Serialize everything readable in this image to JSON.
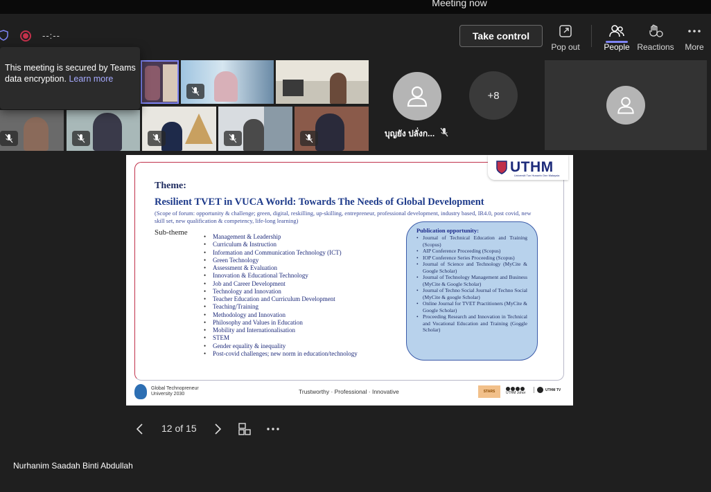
{
  "window": {
    "title": "Meeting now"
  },
  "toolbar": {
    "timer": "--:--",
    "take_control_label": "Take control",
    "pop_out_label": "Pop out",
    "people_label": "People",
    "reactions_label": "Reactions",
    "more_label": "More",
    "accent_color": "#7f85f5"
  },
  "tooltip": {
    "text": "This meeting is secured by Teams data encryption.",
    "link": "Learn more"
  },
  "participants": {
    "named_participant": "บุญยัง ปลั่งก...",
    "overflow_count": "+8"
  },
  "slide": {
    "logo_text": "UTHM",
    "logo_subtext": "Universiti Tun Hussein Onn Malaysia",
    "theme_label": "Theme:",
    "heading": "Resilient TVET in VUCA World: Towards The Needs of Global Development",
    "scope": "(Scope of forum: opportunity & challenge; green, digital, reskilling, up-skilling, entrepreneur, professional development, industry based, IR4.0, post covid, new skill set, new qualification & competency, life-long learning)",
    "subtheme_label": "Sub-theme",
    "subthemes": [
      "Management & Leadership",
      "Curriculum & Instruction",
      "Information and Communication Technology (ICT)",
      "Green Technology",
      "Assessment & Evaluation",
      "Innovation & Educational Technology",
      "Job and Career Development",
      "Technology and Innovation",
      "Teacher Education and Curriculum Development",
      "Teaching/Training",
      "Methodology and Innovation",
      "Philosophy and Values in Education",
      "Mobility and Internationalisation",
      "STEM",
      "Gender equality & inequality",
      "Post-covid challenges; new norm in education/technology"
    ],
    "publication_title": "Publication opportunity:",
    "publications": [
      "Journal of Technical Education and Training (Scopus)",
      "AIP Conference Proceeding (Scopus)",
      "IOP Conference Series Proceeding (Scopus)",
      "Journal of Science and Technology (MyCite & Google Scholar)",
      "Journal of Technology Management and Business (MyCite & Google Scholar)",
      "Journal of Techno Social Journal of Techno Social (MyCite & google Scholar)",
      "Online Journal for TVET Practitioners (MyCite & Google Scholar)",
      "Proceeding Research and Innovation in Technical and Vocational Education and Training (Goggle Scholar)"
    ],
    "footer_left_line1": "Global Technopreneur",
    "footer_left_line2": "University 2030",
    "footer_center": "Trustworthy · Professional · Innovative",
    "footer_stars": "STARS",
    "footer_social": "UTHM Johor",
    "footer_tv": "UTHM TV"
  },
  "navigation": {
    "page_indicator": "12 of 15"
  },
  "presenter": {
    "name": "Nurhanim Saadah Binti Abdullah"
  }
}
